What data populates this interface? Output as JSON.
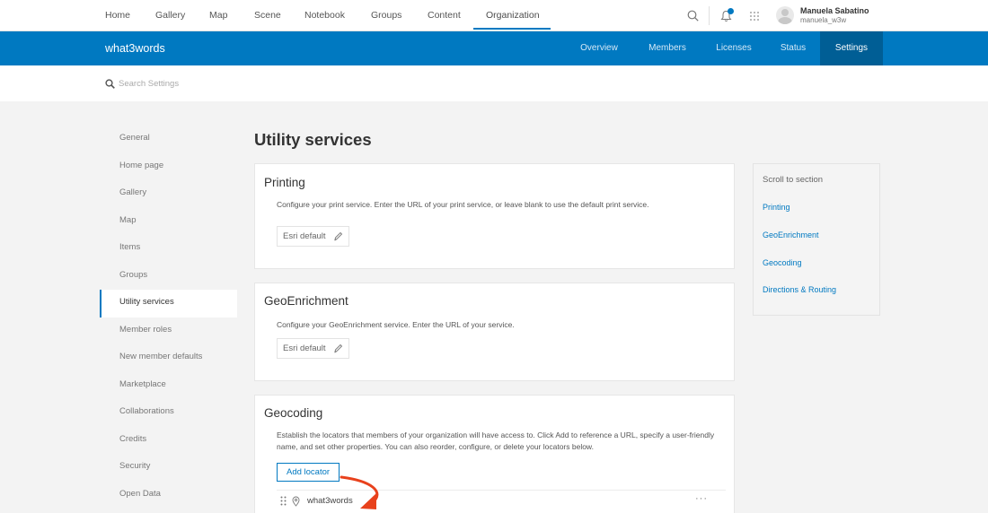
{
  "topnav": {
    "links": [
      {
        "label": "Home"
      },
      {
        "label": "Gallery"
      },
      {
        "label": "Map"
      },
      {
        "label": "Scene"
      },
      {
        "label": "Notebook"
      },
      {
        "label": "Groups"
      },
      {
        "label": "Content"
      },
      {
        "label": "Organization"
      }
    ],
    "active": "Organization",
    "user": {
      "name": "Manuela Sabatino",
      "username": "manuela_w3w"
    },
    "icons": [
      "search-icon",
      "notifications-icon",
      "app-launcher-icon",
      "avatar"
    ],
    "notification_badge": true
  },
  "org": {
    "title": "what3words",
    "tabs": [
      {
        "label": "Overview"
      },
      {
        "label": "Members"
      },
      {
        "label": "Licenses"
      },
      {
        "label": "Status"
      },
      {
        "label": "Settings"
      }
    ],
    "active_tab": "Settings"
  },
  "search": {
    "placeholder": "Search Settings"
  },
  "sidenav": {
    "items": [
      {
        "label": "General"
      },
      {
        "label": "Home page"
      },
      {
        "label": "Gallery"
      },
      {
        "label": "Map"
      },
      {
        "label": "Items"
      },
      {
        "label": "Groups"
      },
      {
        "label": "Utility services"
      },
      {
        "label": "Member roles"
      },
      {
        "label": "New member defaults"
      },
      {
        "label": "Marketplace"
      },
      {
        "label": "Collaborations"
      },
      {
        "label": "Credits"
      },
      {
        "label": "Security"
      },
      {
        "label": "Open Data"
      }
    ],
    "active": "Utility services"
  },
  "main": {
    "title": "Utility services",
    "printing": {
      "title": "Printing",
      "description": "Configure your print service. Enter the URL of your print service, or leave blank to use the default print service.",
      "value": "Esri default"
    },
    "geoenrichment": {
      "title": "GeoEnrichment",
      "description": "Configure your GeoEnrichment service. Enter the URL of your service.",
      "value": "Esri default"
    },
    "geocoding": {
      "title": "Geocoding",
      "description": "Establish the locators that members of your organization will have access to. Click Add to reference a URL, specify a user-friendly name, and set other properties. You can also reorder, configure, or delete your locators below.",
      "add_label": "Add locator",
      "locators": [
        {
          "name": "what3words"
        }
      ],
      "more_label": "···"
    }
  },
  "toc": {
    "heading": "Scroll to section",
    "links": [
      {
        "label": "Printing"
      },
      {
        "label": "GeoEnrichment"
      },
      {
        "label": "Geocoding"
      },
      {
        "label": "Directions & Routing"
      }
    ]
  },
  "colors": {
    "accent": "#0079c1",
    "accent_dark": "#005e95",
    "annotation": "#e8411c"
  }
}
